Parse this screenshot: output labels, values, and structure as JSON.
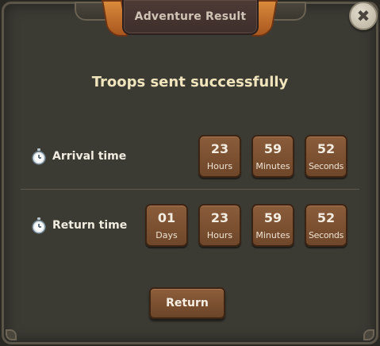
{
  "dialog": {
    "title": "Adventure Result",
    "headline": "Troops sent successfully",
    "close_icon": "close-icon",
    "return_button_label": "Return"
  },
  "arrival": {
    "label": "Arrival time",
    "icon": "stopwatch-icon",
    "units": [
      {
        "value": "23",
        "label": "Hours"
      },
      {
        "value": "59",
        "label": "Minutes"
      },
      {
        "value": "52",
        "label": "Seconds"
      }
    ]
  },
  "return_time": {
    "label": "Return time",
    "icon": "stopwatch-icon",
    "units": [
      {
        "value": "01",
        "label": "Days"
      },
      {
        "value": "23",
        "label": "Hours"
      },
      {
        "value": "59",
        "label": "Minutes"
      },
      {
        "value": "52",
        "label": "Seconds"
      }
    ]
  },
  "colors": {
    "panel": "#3b3a33",
    "tile": "#7c5334",
    "headline": "#efe4bc",
    "accent_horn": "#c9772f"
  }
}
